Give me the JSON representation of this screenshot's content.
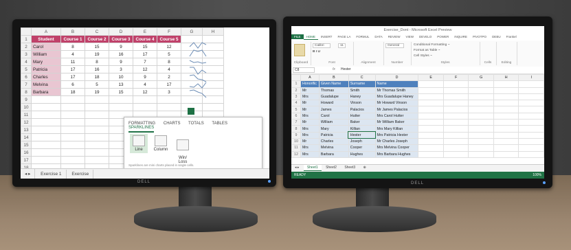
{
  "left_screen": {
    "columns": [
      "A",
      "B",
      "C",
      "D",
      "E",
      "F",
      "G",
      "H"
    ],
    "headers": [
      "Student",
      "Course 1",
      "Course 2",
      "Course 3",
      "Course 4",
      "Course 5"
    ],
    "rows": [
      {
        "n": "1"
      },
      {
        "n": "2",
        "name": "Carol",
        "v": [
          "8",
          "15",
          "9",
          "15",
          "12"
        ]
      },
      {
        "n": "3",
        "name": "William",
        "v": [
          "4",
          "19",
          "16",
          "17",
          "5"
        ]
      },
      {
        "n": "4",
        "name": "Mary",
        "v": [
          "11",
          "8",
          "9",
          "7",
          "8"
        ]
      },
      {
        "n": "5",
        "name": "Patricia",
        "v": [
          "17",
          "16",
          "3",
          "12",
          "4"
        ]
      },
      {
        "n": "6",
        "name": "Charles",
        "v": [
          "17",
          "18",
          "10",
          "9",
          "2"
        ]
      },
      {
        "n": "7",
        "name": "Melvina",
        "v": [
          "6",
          "5",
          "13",
          "4",
          "17"
        ]
      },
      {
        "n": "8",
        "name": "Barbara",
        "v": [
          "18",
          "19",
          "15",
          "12",
          "3"
        ]
      }
    ],
    "empty_rows": [
      "9",
      "10",
      "11",
      "12",
      "13",
      "14",
      "15",
      "16",
      "17",
      "18"
    ],
    "quick_analysis": {
      "tabs": [
        "FORMATTING",
        "CHARTS",
        "TOTALS",
        "TABLES",
        "SPARKLINES"
      ],
      "items": [
        "Line",
        "Column",
        "Win/\nLoss"
      ],
      "note": "Sparklines are mini charts placed in single cells."
    },
    "sheet_tabs": [
      "Exercise 1",
      "Exercise"
    ]
  },
  "right_screen": {
    "title": "Exercise_Dont - Microsoft Excel Preview",
    "ribbon_tabs": [
      "FILE",
      "HOME",
      "INSERT",
      "PAGE LA",
      "FORMUL",
      "DATA",
      "REVIEW",
      "VIEW",
      "DEVELO",
      "POWER",
      "INQUIRE",
      "PIVOTPO",
      "DEBU",
      "Frankel"
    ],
    "ribbon_groups": [
      "Clipboard",
      "Font",
      "Alignment",
      "Number",
      "Styles",
      "Cells",
      "Editing"
    ],
    "font_name": "Calibri",
    "font_size": "11",
    "number_format": "General",
    "styles": [
      "Conditional Formatting ~",
      "Format as Table ~",
      "Cell Styles ~"
    ],
    "name_box": "C8",
    "formula": "Hester",
    "columns": [
      "A",
      "B",
      "C",
      "D",
      "E",
      "F",
      "G",
      "H",
      "I"
    ],
    "header_row": [
      "Honorific",
      "Given Name",
      "Surname",
      "Name"
    ],
    "rows": [
      {
        "n": "2",
        "a": "Mr",
        "b": "Thomas",
        "c": "Smith",
        "d": "Mr Thomas Smith"
      },
      {
        "n": "3",
        "a": "Mrs",
        "b": "Guadalupe",
        "c": "Haney",
        "d": "Mrs Guadalupe Haney"
      },
      {
        "n": "4",
        "a": "Mr",
        "b": "Howard",
        "c": "Vinson",
        "d": "Mr Howard Vinson"
      },
      {
        "n": "5",
        "a": "Mr",
        "b": "James",
        "c": "Palacios",
        "d": "Mr James Palacios"
      },
      {
        "n": "6",
        "a": "Mrs",
        "b": "Carol",
        "c": "Hutter",
        "d": "Mrs Carol Hutter"
      },
      {
        "n": "7",
        "a": "Mr",
        "b": "William",
        "c": "Baker",
        "d": "Mr William Baker"
      },
      {
        "n": "8",
        "a": "Mrs",
        "b": "Mary",
        "c": "Killian",
        "d": "Mrs Mary Killian"
      },
      {
        "n": "9",
        "a": "Mrs",
        "b": "Patricia",
        "c": "Hester",
        "d": "Mrs Patricia Hester"
      },
      {
        "n": "10",
        "a": "Mr",
        "b": "Charles",
        "c": "Joseph",
        "d": "Mr Charles Joseph"
      },
      {
        "n": "11",
        "a": "Mrs",
        "b": "Melvina",
        "c": "Cooper",
        "d": "Mrs Melvina Cooper"
      },
      {
        "n": "12",
        "a": "Mrs",
        "b": "Barbara",
        "c": "Hughes",
        "d": "Mrs Barbara Hughes"
      }
    ],
    "sheet_tabs": [
      "Sheet1",
      "Sheet2",
      "Sheet3"
    ],
    "status_left": "READY",
    "zoom": "100%"
  },
  "monitor_brand": "DELL"
}
